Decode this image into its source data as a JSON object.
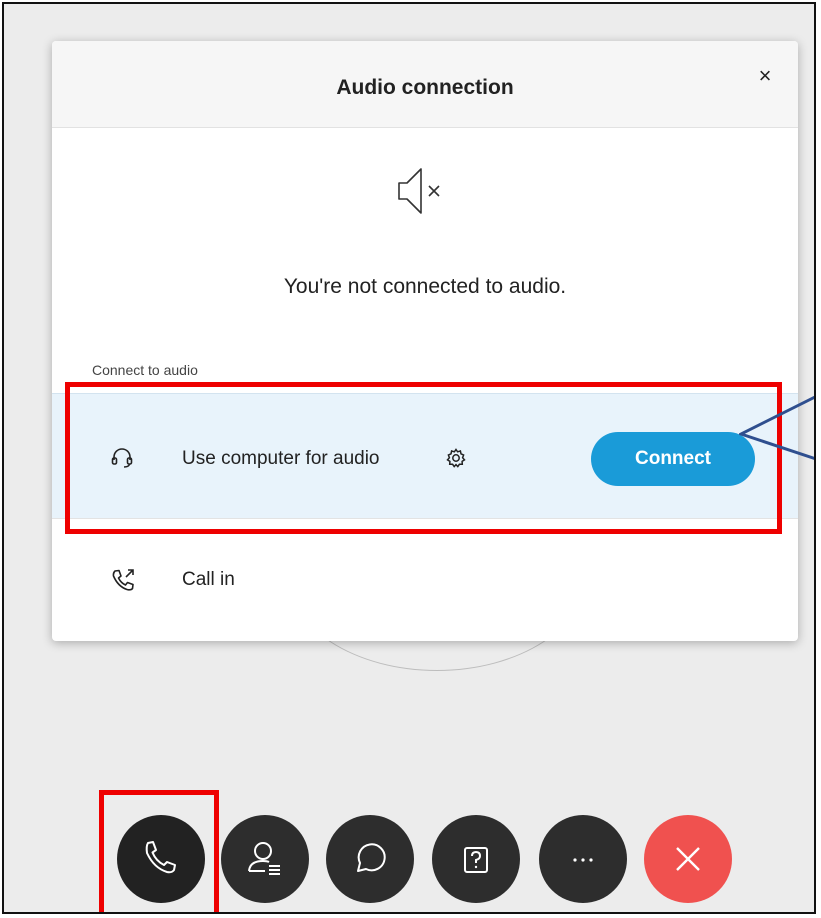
{
  "dialog": {
    "title": "Audio connection",
    "close_glyph": "×",
    "status_icon": "speaker-muted-icon",
    "status_text": "You're not connected to audio.",
    "section_label": "Connect to audio",
    "options": [
      {
        "label": "Use computer for audio",
        "icon": "headset-icon",
        "settings_icon": "gear-icon",
        "action_label": "Connect"
      },
      {
        "label": "Call in",
        "icon": "phone-callout-icon"
      }
    ]
  },
  "toolbar": {
    "buttons": [
      {
        "icon": "phone-icon"
      },
      {
        "icon": "participants-icon"
      },
      {
        "icon": "chat-icon"
      },
      {
        "icon": "qa-icon"
      },
      {
        "icon": "more-icon"
      },
      {
        "icon": "close-icon"
      }
    ]
  },
  "colors": {
    "accent": "#1a9bd8",
    "highlight": "#ee0000",
    "leave": "#f0514f",
    "row_selected": "#e8f3fb",
    "callout": "#2f4f8f"
  }
}
